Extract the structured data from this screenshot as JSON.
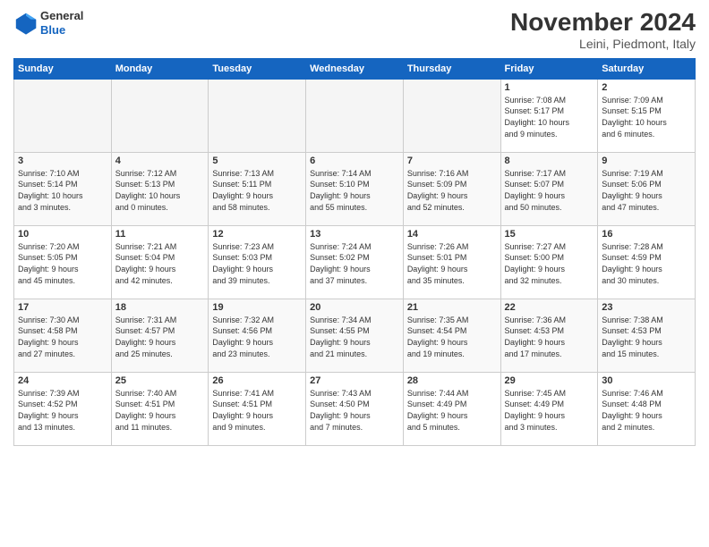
{
  "header": {
    "logo_line1": "General",
    "logo_line2": "Blue",
    "month_title": "November 2024",
    "location": "Leini, Piedmont, Italy"
  },
  "weekdays": [
    "Sunday",
    "Monday",
    "Tuesday",
    "Wednesday",
    "Thursday",
    "Friday",
    "Saturday"
  ],
  "weeks": [
    [
      {
        "day": "",
        "info": ""
      },
      {
        "day": "",
        "info": ""
      },
      {
        "day": "",
        "info": ""
      },
      {
        "day": "",
        "info": ""
      },
      {
        "day": "",
        "info": ""
      },
      {
        "day": "1",
        "info": "Sunrise: 7:08 AM\nSunset: 5:17 PM\nDaylight: 10 hours\nand 9 minutes."
      },
      {
        "day": "2",
        "info": "Sunrise: 7:09 AM\nSunset: 5:15 PM\nDaylight: 10 hours\nand 6 minutes."
      }
    ],
    [
      {
        "day": "3",
        "info": "Sunrise: 7:10 AM\nSunset: 5:14 PM\nDaylight: 10 hours\nand 3 minutes."
      },
      {
        "day": "4",
        "info": "Sunrise: 7:12 AM\nSunset: 5:13 PM\nDaylight: 10 hours\nand 0 minutes."
      },
      {
        "day": "5",
        "info": "Sunrise: 7:13 AM\nSunset: 5:11 PM\nDaylight: 9 hours\nand 58 minutes."
      },
      {
        "day": "6",
        "info": "Sunrise: 7:14 AM\nSunset: 5:10 PM\nDaylight: 9 hours\nand 55 minutes."
      },
      {
        "day": "7",
        "info": "Sunrise: 7:16 AM\nSunset: 5:09 PM\nDaylight: 9 hours\nand 52 minutes."
      },
      {
        "day": "8",
        "info": "Sunrise: 7:17 AM\nSunset: 5:07 PM\nDaylight: 9 hours\nand 50 minutes."
      },
      {
        "day": "9",
        "info": "Sunrise: 7:19 AM\nSunset: 5:06 PM\nDaylight: 9 hours\nand 47 minutes."
      }
    ],
    [
      {
        "day": "10",
        "info": "Sunrise: 7:20 AM\nSunset: 5:05 PM\nDaylight: 9 hours\nand 45 minutes."
      },
      {
        "day": "11",
        "info": "Sunrise: 7:21 AM\nSunset: 5:04 PM\nDaylight: 9 hours\nand 42 minutes."
      },
      {
        "day": "12",
        "info": "Sunrise: 7:23 AM\nSunset: 5:03 PM\nDaylight: 9 hours\nand 39 minutes."
      },
      {
        "day": "13",
        "info": "Sunrise: 7:24 AM\nSunset: 5:02 PM\nDaylight: 9 hours\nand 37 minutes."
      },
      {
        "day": "14",
        "info": "Sunrise: 7:26 AM\nSunset: 5:01 PM\nDaylight: 9 hours\nand 35 minutes."
      },
      {
        "day": "15",
        "info": "Sunrise: 7:27 AM\nSunset: 5:00 PM\nDaylight: 9 hours\nand 32 minutes."
      },
      {
        "day": "16",
        "info": "Sunrise: 7:28 AM\nSunset: 4:59 PM\nDaylight: 9 hours\nand 30 minutes."
      }
    ],
    [
      {
        "day": "17",
        "info": "Sunrise: 7:30 AM\nSunset: 4:58 PM\nDaylight: 9 hours\nand 27 minutes."
      },
      {
        "day": "18",
        "info": "Sunrise: 7:31 AM\nSunset: 4:57 PM\nDaylight: 9 hours\nand 25 minutes."
      },
      {
        "day": "19",
        "info": "Sunrise: 7:32 AM\nSunset: 4:56 PM\nDaylight: 9 hours\nand 23 minutes."
      },
      {
        "day": "20",
        "info": "Sunrise: 7:34 AM\nSunset: 4:55 PM\nDaylight: 9 hours\nand 21 minutes."
      },
      {
        "day": "21",
        "info": "Sunrise: 7:35 AM\nSunset: 4:54 PM\nDaylight: 9 hours\nand 19 minutes."
      },
      {
        "day": "22",
        "info": "Sunrise: 7:36 AM\nSunset: 4:53 PM\nDaylight: 9 hours\nand 17 minutes."
      },
      {
        "day": "23",
        "info": "Sunrise: 7:38 AM\nSunset: 4:53 PM\nDaylight: 9 hours\nand 15 minutes."
      }
    ],
    [
      {
        "day": "24",
        "info": "Sunrise: 7:39 AM\nSunset: 4:52 PM\nDaylight: 9 hours\nand 13 minutes."
      },
      {
        "day": "25",
        "info": "Sunrise: 7:40 AM\nSunset: 4:51 PM\nDaylight: 9 hours\nand 11 minutes."
      },
      {
        "day": "26",
        "info": "Sunrise: 7:41 AM\nSunset: 4:51 PM\nDaylight: 9 hours\nand 9 minutes."
      },
      {
        "day": "27",
        "info": "Sunrise: 7:43 AM\nSunset: 4:50 PM\nDaylight: 9 hours\nand 7 minutes."
      },
      {
        "day": "28",
        "info": "Sunrise: 7:44 AM\nSunset: 4:49 PM\nDaylight: 9 hours\nand 5 minutes."
      },
      {
        "day": "29",
        "info": "Sunrise: 7:45 AM\nSunset: 4:49 PM\nDaylight: 9 hours\nand 3 minutes."
      },
      {
        "day": "30",
        "info": "Sunrise: 7:46 AM\nSunset: 4:48 PM\nDaylight: 9 hours\nand 2 minutes."
      }
    ]
  ]
}
